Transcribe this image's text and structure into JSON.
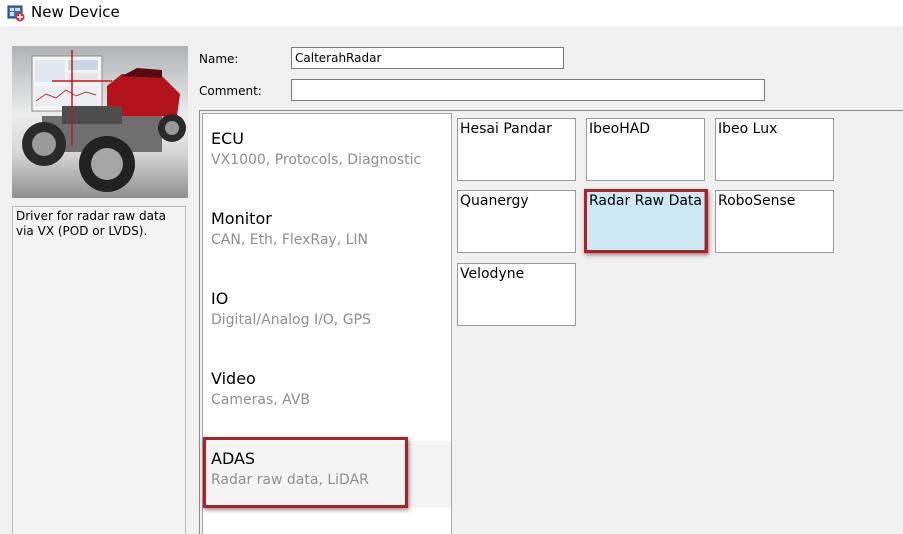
{
  "window": {
    "title": "New Device",
    "icon": "new-device-icon"
  },
  "form": {
    "name_label": "Name:",
    "name_value": "CalterahRadar",
    "comment_label": "Comment:",
    "comment_value": ""
  },
  "description": {
    "text": "Driver for radar raw data via VX (POD or LVDS)."
  },
  "categories": [
    {
      "name": "ECU",
      "subtitle": "VX1000, Protocols, Diagnostic"
    },
    {
      "name": "Monitor",
      "subtitle": "CAN, Eth, FlexRay, LIN"
    },
    {
      "name": "IO",
      "subtitle": "Digital/Analog I/O, GPS"
    },
    {
      "name": "Video",
      "subtitle": "Cameras, AVB"
    },
    {
      "name": "ADAS",
      "subtitle": "Radar raw data, LiDAR",
      "selected": true
    }
  ],
  "devices": [
    {
      "label": "Hesai Pandar"
    },
    {
      "label": "IbeoHAD"
    },
    {
      "label": "Ibeo Lux"
    },
    {
      "label": "Quanergy"
    },
    {
      "label": "Radar Raw Data",
      "selected": true
    },
    {
      "label": "RoboSense"
    },
    {
      "label": "Velodyne"
    }
  ],
  "colors": {
    "selected_tile": "#cce8f4",
    "selected_category": "#f4f4f4",
    "annotation_border": "#b01f24",
    "subtitle_text": "#8f8f8f"
  }
}
